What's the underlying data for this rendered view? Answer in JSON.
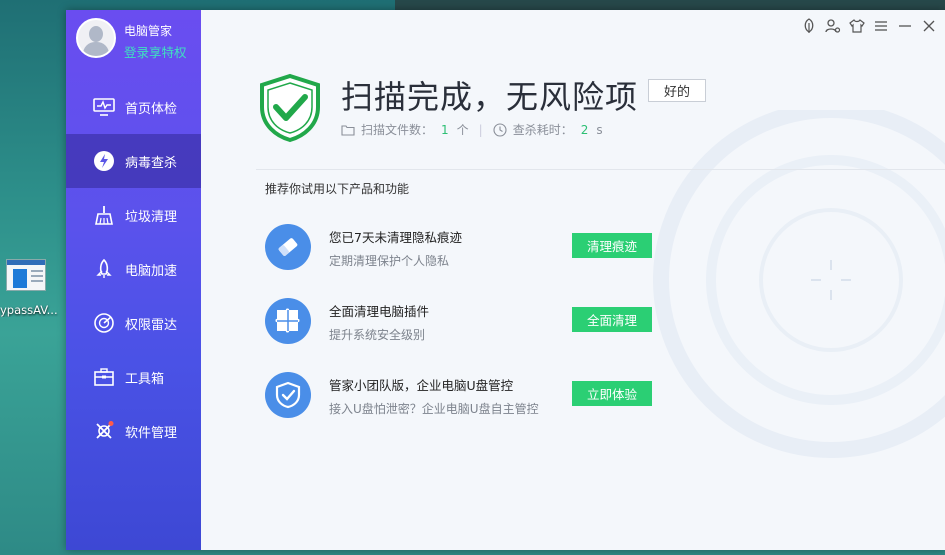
{
  "desktop": {
    "icon_label": "ypassAV..."
  },
  "app": {
    "name": "电脑管家",
    "vip_link": "登录享特权"
  },
  "sidebar": {
    "items": [
      {
        "label": "首页体检",
        "icon": "monitor-icon"
      },
      {
        "label": "病毒查杀",
        "icon": "bolt-icon"
      },
      {
        "label": "垃圾清理",
        "icon": "broom-icon"
      },
      {
        "label": "电脑加速",
        "icon": "rocket-icon"
      },
      {
        "label": "权限雷达",
        "icon": "radar-icon"
      },
      {
        "label": "工具箱",
        "icon": "toolbox-icon"
      },
      {
        "label": "软件管理",
        "icon": "apps-icon"
      }
    ],
    "active_index": 1
  },
  "titlebar": {
    "icons": [
      "leaf-icon",
      "user-settings-icon",
      "skin-icon",
      "menu-icon",
      "minimize-icon",
      "close-icon"
    ]
  },
  "result": {
    "headline": "扫描完成，无风险项",
    "ok_label": "好的",
    "files_label": "扫描文件数：",
    "files_count": "1",
    "files_unit": "个",
    "time_label": "查杀耗时：",
    "time_value": "2",
    "time_unit": "s"
  },
  "recommend": {
    "title": "推荐你试用以下产品和功能",
    "items": [
      {
        "title": "您已7天未清理隐私痕迹",
        "subtitle": "定期清理保护个人隐私",
        "button": "清理痕迹",
        "icon": "eraser-icon"
      },
      {
        "title": "全面清理电脑插件",
        "subtitle": "提升系统安全级别",
        "button": "全面清理",
        "icon": "puzzle-icon"
      },
      {
        "title": "管家小团队版，企业电脑U盘管控",
        "subtitle": "接入U盘怕泄密？企业电脑U盘自主管控",
        "button": "立即体验",
        "icon": "shield-check-icon"
      }
    ]
  },
  "colors": {
    "accent_green": "#2bcf74",
    "sidebar_top": "#6a4df0",
    "sidebar_bottom": "#3d48d4",
    "vip_text": "#3fe0c0"
  }
}
